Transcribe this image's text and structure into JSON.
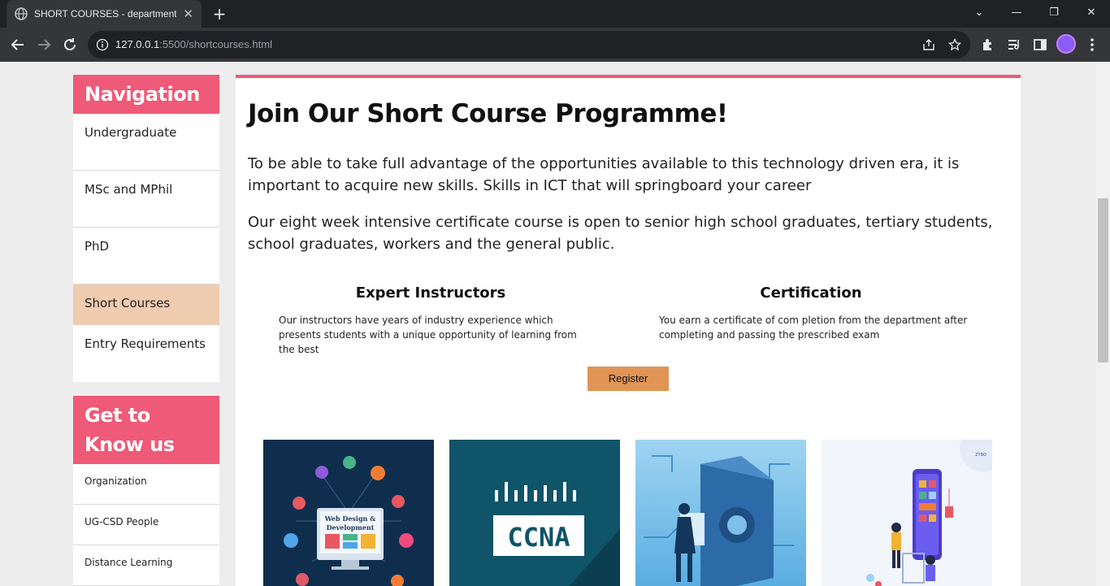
{
  "browser": {
    "tab_title": "SHORT COURSES - department of",
    "tab_close": "✕",
    "new_tab": "+",
    "url_host": "127.0.0.1",
    "url_rest": ":5500/shortcourses.html",
    "window_controls": {
      "dropdown": "⌄",
      "minimize": "—",
      "restore": "❐",
      "close": "✕"
    }
  },
  "sidebar": {
    "navigation_heading": "Navigation",
    "nav_items": [
      {
        "label": "Undergraduate"
      },
      {
        "label": "MSc and MPhil"
      },
      {
        "label": "PhD"
      },
      {
        "label": "Short Courses",
        "active": true
      },
      {
        "label": "Entry Requirements"
      }
    ],
    "know_heading": "Get to Know us",
    "know_items": [
      {
        "label": "Organization"
      },
      {
        "label": "UG-CSD People"
      },
      {
        "label": "Distance Learning"
      }
    ]
  },
  "main": {
    "heading": "Join Our Short Course Programme!",
    "paragraph_1": "To be able to take full advantage of the opportunities available to this technology driven era, it is important to acquire new skills. Skills in ICT that will springboard your career",
    "paragraph_2": "Our eight week intensive certificate course is open to senior high school graduates, tertiary students, school graduates, workers and the general public.",
    "features": [
      {
        "title": "Expert Instructors",
        "text": "Our instructors have years of industry experience which presents students with a unique opportunity of learning from the best"
      },
      {
        "title": "Certification",
        "text": "You earn a certificate of com pletion from the department after completing and passing the prescribed exam"
      }
    ],
    "register_label": "Register",
    "course_cards": [
      {
        "image_text_1": "Web Design &",
        "image_text_2": "Development"
      },
      {
        "image_text": "CCNA"
      },
      {
        "image_text": ""
      },
      {
        "image_text": "ZYBO"
      }
    ]
  },
  "colors": {
    "accent_pink": "#ee5a77",
    "active_item": "#efcbb0",
    "register_button": "#e09556"
  }
}
